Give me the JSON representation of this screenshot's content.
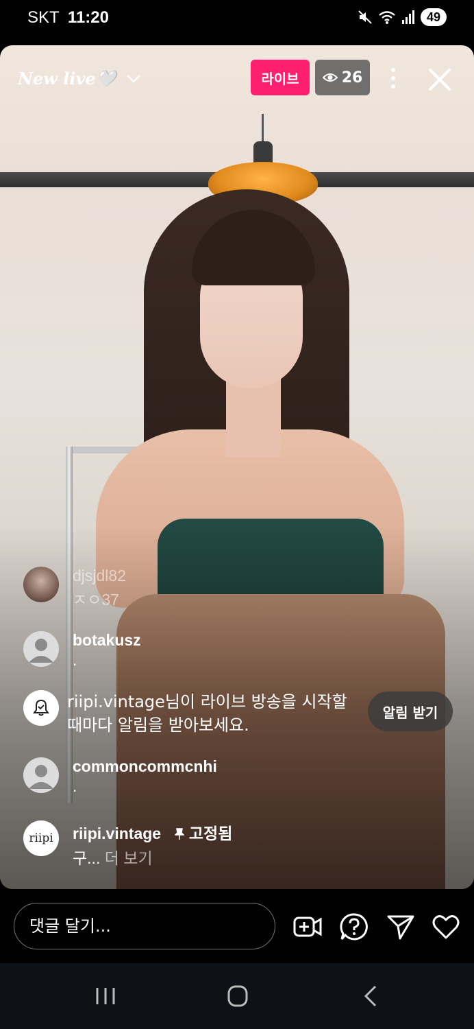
{
  "status_bar": {
    "carrier": "SKT",
    "time": "11:20",
    "battery": "49"
  },
  "live": {
    "title": "New live🤍",
    "live_badge": "라이브",
    "viewer_count": "26"
  },
  "comments": [
    {
      "user": "djsjdl82",
      "text": "ㅈㅇ37",
      "avatar": "photo"
    },
    {
      "user": "botakusz",
      "text": ".",
      "avatar": "default"
    }
  ],
  "notification": {
    "text": "riipi.vintage님이 라이브 방송을 시작할 때마다 알림을 받아보세요.",
    "button": "알림 받기"
  },
  "comments_after": [
    {
      "user": "commoncommcnhi",
      "text": ".",
      "avatar": "default"
    }
  ],
  "pinned": {
    "user": "riipi.vintage",
    "pin_label": "고정됨",
    "text": "구...",
    "more": "더 보기",
    "avatar_text": "riipi"
  },
  "bottom": {
    "placeholder": "댓글 달기...",
    "icons": [
      "add-video-icon",
      "question-icon",
      "send-icon",
      "heart-icon"
    ]
  },
  "nav": {
    "icons": [
      "recent-apps-icon",
      "home-icon",
      "back-icon"
    ]
  }
}
